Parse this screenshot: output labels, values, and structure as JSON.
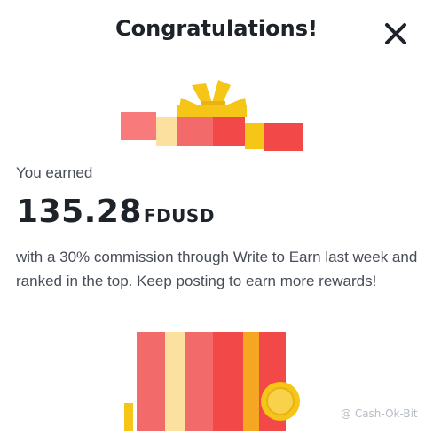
{
  "dialog": {
    "title": "Congratulations!",
    "close_icon": "close-icon"
  },
  "reward": {
    "earned_label": "You earned",
    "amount": "135.28",
    "currency": "FDUSD",
    "description": "with a 30% commission through Write to Earn last week and ranked in the top. Keep posting to earn more rewards!"
  },
  "illustration": {
    "lid_icon": "gift-lid-icon",
    "box_icon": "gift-box-icon",
    "coin_icon": "coin-icon"
  },
  "watermark": {
    "text": "@ Cash-Ok-Bit"
  },
  "colors": {
    "red": "#f24848",
    "pink": "#f87a7a",
    "yellow": "#f5c518",
    "cream": "#fbe0a0",
    "text_primary": "#1e2329",
    "text_secondary": "#474d57"
  }
}
